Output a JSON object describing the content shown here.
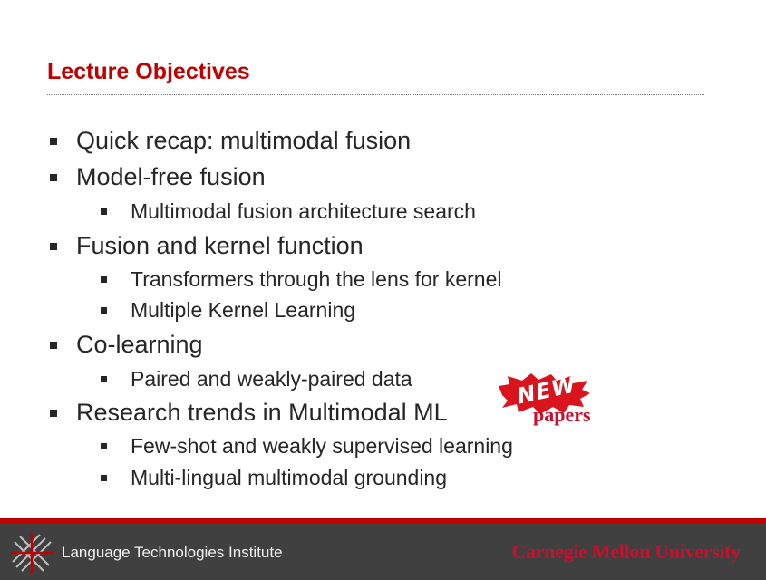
{
  "slide": {
    "title": "Lecture Objectives"
  },
  "bullets": [
    {
      "level": 1,
      "text": "Quick recap: multimodal fusion"
    },
    {
      "level": 1,
      "text": "Model-free fusion"
    },
    {
      "level": 2,
      "text": "Multimodal fusion architecture search"
    },
    {
      "level": 1,
      "text": "Fusion and kernel function"
    },
    {
      "level": 2,
      "text": "Transformers through the lens for kernel"
    },
    {
      "level": 2,
      "text": "Multiple Kernel Learning"
    },
    {
      "level": 1,
      "text": "Co-learning"
    },
    {
      "level": 2,
      "text": "Paired and weakly-paired data"
    },
    {
      "level": 1,
      "text": "Research trends in Multimodal ML"
    },
    {
      "level": 2,
      "text": "Few-shot and weakly supervised learning"
    },
    {
      "level": 2,
      "text": "Multi-lingual multimodal grounding"
    }
  ],
  "stamp": {
    "new_label": "NEW",
    "papers_label": "papers"
  },
  "footer": {
    "institute": "Language Technologies Institute",
    "university": "Carnegie Mellon University"
  },
  "colors": {
    "title_red": "#c00000",
    "body_text": "#262626",
    "footer_bg": "#404040",
    "footer_stripe": "#c00000",
    "cmu_red": "#c8102e"
  },
  "icons": {
    "bullet": "square-bullet-icon",
    "lti_logo": "lti-logo-icon",
    "stamp": "new-splash-icon"
  }
}
